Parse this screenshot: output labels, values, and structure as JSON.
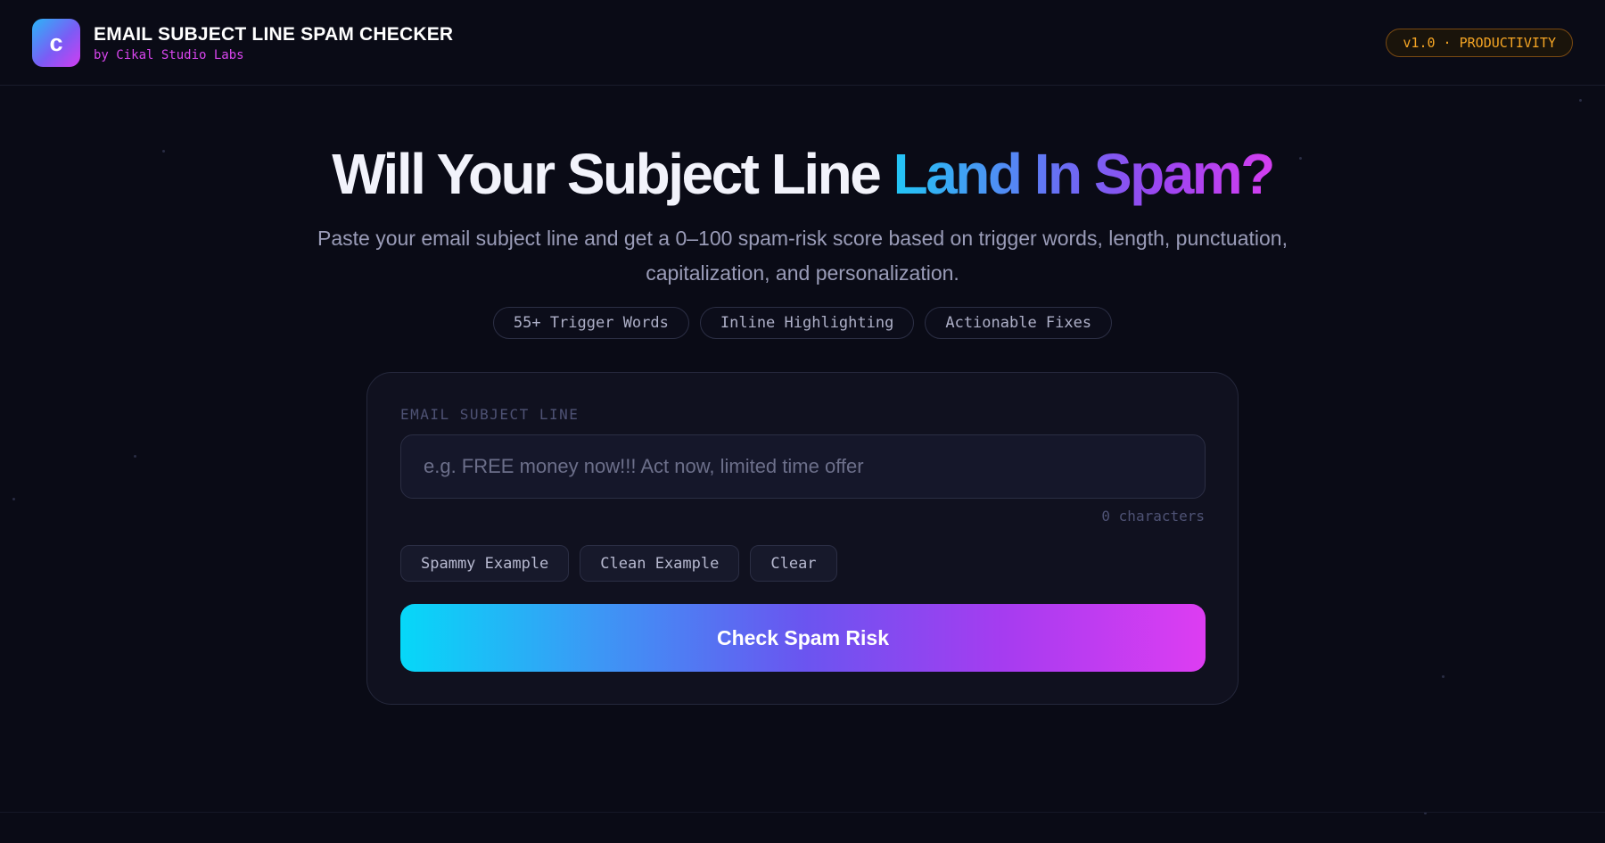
{
  "header": {
    "logo_letter": "c",
    "title": "EMAIL SUBJECT LINE SPAM CHECKER",
    "subtitle": "by Cikal Studio Labs",
    "version_badge": "v1.0 · PRODUCTIVITY"
  },
  "hero": {
    "title_plain": "Will Your Subject Line ",
    "title_highlight": "Land In Spam?",
    "description": "Paste your email subject line and get a 0–100 spam-risk score based on trigger words, length, punctuation, capitalization, and personalization.",
    "chips": [
      "55+ Trigger Words",
      "Inline Highlighting",
      "Actionable Fixes"
    ]
  },
  "form": {
    "label": "EMAIL SUBJECT LINE",
    "input_value": "",
    "input_placeholder": "e.g. FREE money now!!! Act now, limited time offer",
    "char_count": "0 characters",
    "example_buttons": [
      "Spammy Example",
      "Clean Example",
      "Clear"
    ],
    "submit_label": "Check Spam Risk"
  },
  "colors": {
    "background": "#0a0b16",
    "accent_magenta": "#d946ef",
    "accent_cyan": "#06d8f8",
    "badge_amber": "#f5a524"
  }
}
